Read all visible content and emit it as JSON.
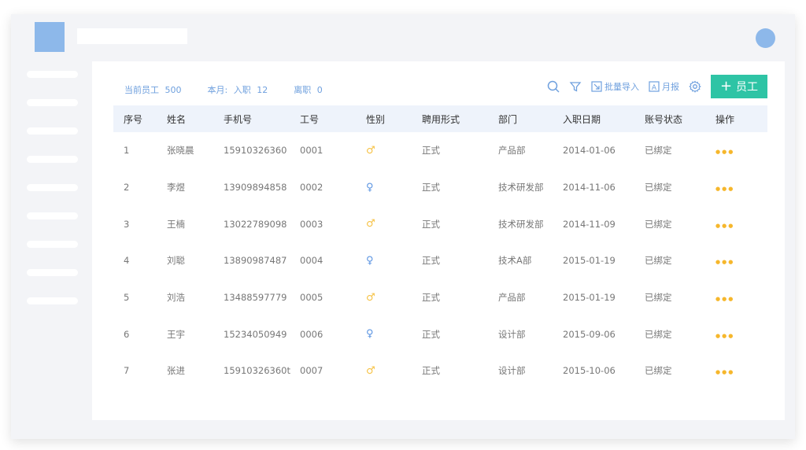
{
  "summary": {
    "current_label": "当前员工",
    "current_count": "500",
    "month_label": "本月:",
    "hired_label": "入职",
    "hired_count": "12",
    "left_label": "离职",
    "left_count": "0"
  },
  "toolbar": {
    "search_icon": "search-icon",
    "filter_icon": "filter-icon",
    "import_label": "批量导入",
    "report_label": "月报",
    "settings_icon": "gear-icon",
    "add_label": "员工"
  },
  "table": {
    "headers": [
      "序号",
      "姓名",
      "手机号",
      "工号",
      "性别",
      "聘用形式",
      "部门",
      "入职日期",
      "账号状态",
      "操作"
    ],
    "rows": [
      {
        "idx": "1",
        "name": "张晓晨",
        "phone": "15910326360",
        "id": "0001",
        "gender": "male",
        "type": "正式",
        "dept": "产品部",
        "date": "2014-01-06",
        "status": "已绑定"
      },
      {
        "idx": "2",
        "name": "李煜",
        "phone": "13909894858",
        "id": "0002",
        "gender": "female",
        "type": "正式",
        "dept": "技术研发部",
        "date": "2014-11-06",
        "status": "已绑定"
      },
      {
        "idx": "3",
        "name": "王楠",
        "phone": "13022789098",
        "id": "0003",
        "gender": "male",
        "type": "正式",
        "dept": "技术研发部",
        "date": "2014-11-09",
        "status": "已绑定"
      },
      {
        "idx": "4",
        "name": "刘聪",
        "phone": "13890987487",
        "id": "0004",
        "gender": "female",
        "type": "正式",
        "dept": "技术A部",
        "date": "2015-01-19",
        "status": "已绑定"
      },
      {
        "idx": "5",
        "name": "刘浩",
        "phone": "13488597779",
        "id": "0005",
        "gender": "male",
        "type": "正式",
        "dept": "产品部",
        "date": "2015-01-19",
        "status": "已绑定"
      },
      {
        "idx": "6",
        "name": "王宇",
        "phone": "15234050949",
        "id": "0006",
        "gender": "female",
        "type": "正式",
        "dept": "设计部",
        "date": "2015-09-06",
        "status": "已绑定"
      },
      {
        "idx": "7",
        "name": "张进",
        "phone": "15910326360t",
        "id": "0007",
        "gender": "male",
        "type": "正式",
        "dept": "设计部",
        "date": "2015-10-06",
        "status": "已绑定"
      }
    ]
  },
  "colors": {
    "accent": "#2ec4a5",
    "link": "#6fa0de",
    "ops": "#f6b72c",
    "male": "#f6c244",
    "female": "#5c95e2",
    "placeholder": "#8db8ea"
  }
}
